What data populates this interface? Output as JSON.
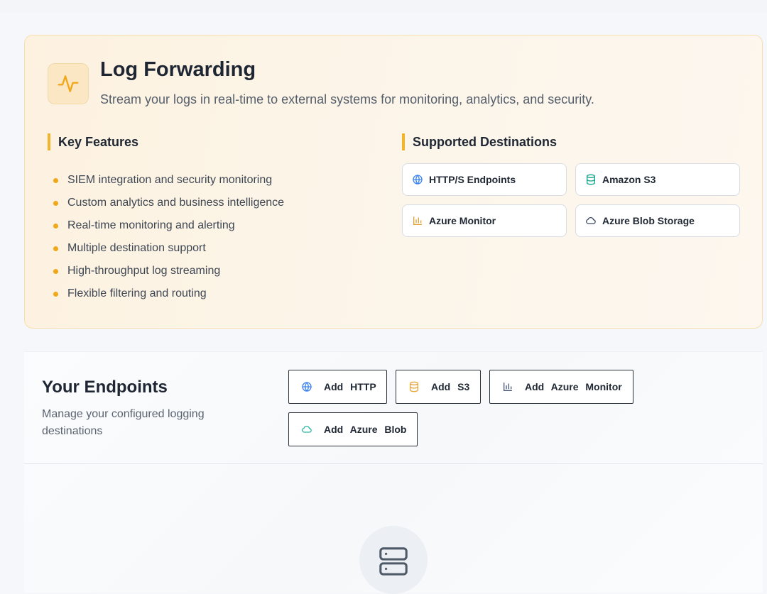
{
  "hero": {
    "title": "Log Forwarding",
    "subtitle": "Stream your logs in real-time to external systems for monitoring, analytics, and security.",
    "icon": "activity-icon"
  },
  "features": {
    "title": "Key Features",
    "items": [
      "SIEM integration and security monitoring",
      "Custom analytics and business intelligence",
      "Real-time monitoring and alerting",
      "Multiple destination support",
      "High-throughput log streaming",
      "Flexible filtering and routing"
    ]
  },
  "destinations": {
    "title": "Supported Destinations",
    "items": [
      {
        "label": "HTTP/S Endpoints",
        "icon": "globe-icon"
      },
      {
        "label": "Amazon S3",
        "icon": "database-icon"
      },
      {
        "label": "Azure Monitor",
        "icon": "bar-chart-icon"
      },
      {
        "label": "Azure Blob Storage",
        "icon": "cloud-icon"
      }
    ]
  },
  "endpoints": {
    "title": "Your Endpoints",
    "subtitle": "Manage your configured logging destinations",
    "buttons": [
      {
        "label": "Add HTTP",
        "icon": "globe-icon"
      },
      {
        "label": "Add S3",
        "icon": "database-icon"
      },
      {
        "label": "Add Azure Monitor",
        "icon": "bar-chart-icon"
      },
      {
        "label": "Add Azure Blob",
        "icon": "cloud-icon"
      }
    ],
    "empty_icon": "server-icon"
  },
  "colors": {
    "accent": "#f3b32b",
    "bullet": "#f2a71a",
    "globe": "#3b82f6",
    "database": "#14a38b",
    "s3_button": "#eaa53a",
    "chart": "#e0a23a",
    "chart_button": "#4a5a78",
    "cloud": "#3a4a66",
    "cloud_button": "#2bb5a3"
  }
}
